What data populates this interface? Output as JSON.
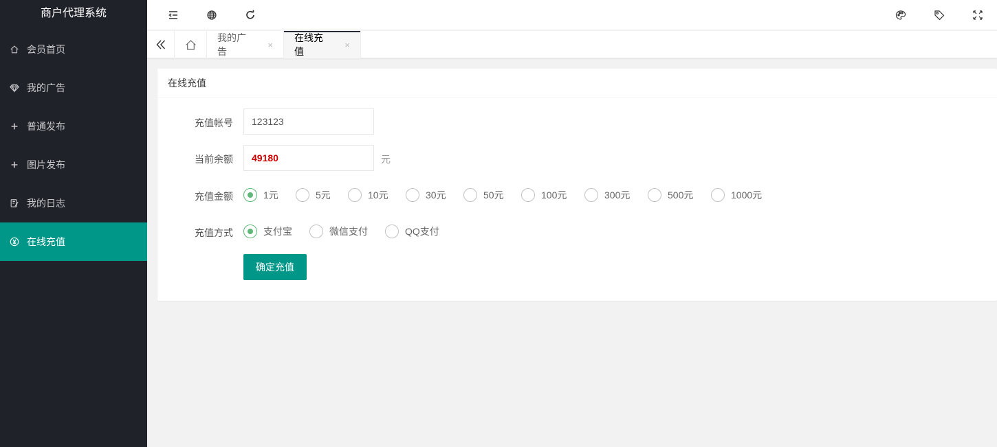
{
  "app": {
    "title": "商户代理系统"
  },
  "sidebar": {
    "items": [
      {
        "label": "会员首页",
        "icon": "home-icon"
      },
      {
        "label": "我的广告",
        "icon": "diamond-icon"
      },
      {
        "label": "普通发布",
        "icon": "plus-icon"
      },
      {
        "label": "图片发布",
        "icon": "plus-icon"
      },
      {
        "label": "我的日志",
        "icon": "log-icon"
      },
      {
        "label": "在线充值",
        "icon": "yen-icon",
        "active": true
      }
    ]
  },
  "header": {
    "left_icons": [
      "menu-fold-icon",
      "globe-icon",
      "refresh-icon"
    ],
    "right_icons": [
      "palette-icon",
      "tag-icon",
      "fullscreen-icon"
    ]
  },
  "tabs": {
    "items": [
      {
        "label": "我的广告",
        "close": "×",
        "active": false
      },
      {
        "label": "在线充值",
        "close": "×",
        "active": true
      }
    ]
  },
  "card": {
    "title": "在线充值",
    "account": {
      "label": "充值帐号",
      "value": "123123"
    },
    "balance": {
      "label": "当前余额",
      "value": "49180",
      "unit": "元"
    },
    "amount": {
      "label": "充值金额",
      "options": [
        "1元",
        "5元",
        "10元",
        "30元",
        "50元",
        "100元",
        "300元",
        "500元",
        "1000元"
      ],
      "selected": "1元"
    },
    "method": {
      "label": "充值方式",
      "options": [
        "支付宝",
        "微信支付",
        "QQ支付"
      ],
      "selected": "支付宝"
    },
    "submit_label": "确定充值"
  },
  "colors": {
    "sidebar_bg": "#20222a",
    "accent": "#009688",
    "radio_checked": "#5FB878",
    "balance_text": "#cc0000"
  }
}
